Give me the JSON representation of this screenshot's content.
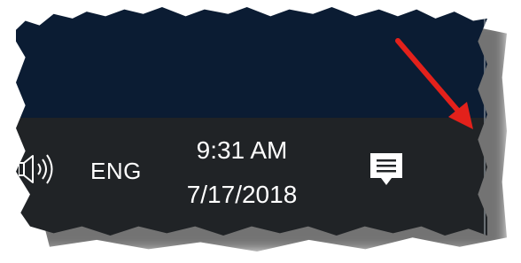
{
  "taskbar": {
    "volume_icon": "speaker-volume-icon",
    "language": "ENG",
    "clock": {
      "time": "9:31 AM",
      "date": "7/17/2018"
    },
    "notification_icon": "action-center-icon"
  },
  "annotation": {
    "arrow_color": "#e3211b"
  },
  "colors": {
    "desktop": "#0b1c33",
    "taskbar": "#202326",
    "text": "#ffffff"
  }
}
